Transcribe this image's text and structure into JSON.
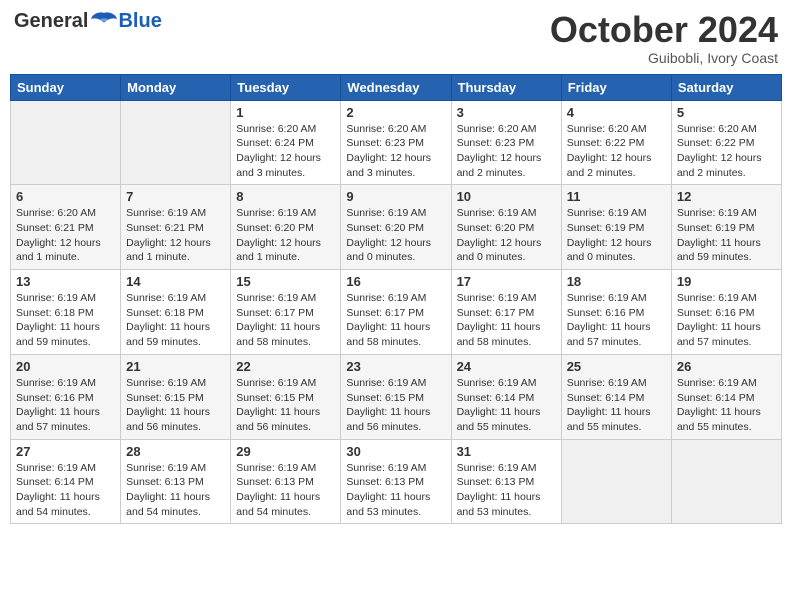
{
  "header": {
    "logo_general": "General",
    "logo_blue": "Blue",
    "month_title": "October 2024",
    "subtitle": "Guibobli, Ivory Coast"
  },
  "days_of_week": [
    "Sunday",
    "Monday",
    "Tuesday",
    "Wednesday",
    "Thursday",
    "Friday",
    "Saturday"
  ],
  "weeks": [
    [
      {
        "day": "",
        "info": ""
      },
      {
        "day": "",
        "info": ""
      },
      {
        "day": "1",
        "info": "Sunrise: 6:20 AM\nSunset: 6:24 PM\nDaylight: 12 hours and 3 minutes."
      },
      {
        "day": "2",
        "info": "Sunrise: 6:20 AM\nSunset: 6:23 PM\nDaylight: 12 hours and 3 minutes."
      },
      {
        "day": "3",
        "info": "Sunrise: 6:20 AM\nSunset: 6:23 PM\nDaylight: 12 hours and 2 minutes."
      },
      {
        "day": "4",
        "info": "Sunrise: 6:20 AM\nSunset: 6:22 PM\nDaylight: 12 hours and 2 minutes."
      },
      {
        "day": "5",
        "info": "Sunrise: 6:20 AM\nSunset: 6:22 PM\nDaylight: 12 hours and 2 minutes."
      }
    ],
    [
      {
        "day": "6",
        "info": "Sunrise: 6:20 AM\nSunset: 6:21 PM\nDaylight: 12 hours and 1 minute."
      },
      {
        "day": "7",
        "info": "Sunrise: 6:19 AM\nSunset: 6:21 PM\nDaylight: 12 hours and 1 minute."
      },
      {
        "day": "8",
        "info": "Sunrise: 6:19 AM\nSunset: 6:20 PM\nDaylight: 12 hours and 1 minute."
      },
      {
        "day": "9",
        "info": "Sunrise: 6:19 AM\nSunset: 6:20 PM\nDaylight: 12 hours and 0 minutes."
      },
      {
        "day": "10",
        "info": "Sunrise: 6:19 AM\nSunset: 6:20 PM\nDaylight: 12 hours and 0 minutes."
      },
      {
        "day": "11",
        "info": "Sunrise: 6:19 AM\nSunset: 6:19 PM\nDaylight: 12 hours and 0 minutes."
      },
      {
        "day": "12",
        "info": "Sunrise: 6:19 AM\nSunset: 6:19 PM\nDaylight: 11 hours and 59 minutes."
      }
    ],
    [
      {
        "day": "13",
        "info": "Sunrise: 6:19 AM\nSunset: 6:18 PM\nDaylight: 11 hours and 59 minutes."
      },
      {
        "day": "14",
        "info": "Sunrise: 6:19 AM\nSunset: 6:18 PM\nDaylight: 11 hours and 59 minutes."
      },
      {
        "day": "15",
        "info": "Sunrise: 6:19 AM\nSunset: 6:17 PM\nDaylight: 11 hours and 58 minutes."
      },
      {
        "day": "16",
        "info": "Sunrise: 6:19 AM\nSunset: 6:17 PM\nDaylight: 11 hours and 58 minutes."
      },
      {
        "day": "17",
        "info": "Sunrise: 6:19 AM\nSunset: 6:17 PM\nDaylight: 11 hours and 58 minutes."
      },
      {
        "day": "18",
        "info": "Sunrise: 6:19 AM\nSunset: 6:16 PM\nDaylight: 11 hours and 57 minutes."
      },
      {
        "day": "19",
        "info": "Sunrise: 6:19 AM\nSunset: 6:16 PM\nDaylight: 11 hours and 57 minutes."
      }
    ],
    [
      {
        "day": "20",
        "info": "Sunrise: 6:19 AM\nSunset: 6:16 PM\nDaylight: 11 hours and 57 minutes."
      },
      {
        "day": "21",
        "info": "Sunrise: 6:19 AM\nSunset: 6:15 PM\nDaylight: 11 hours and 56 minutes."
      },
      {
        "day": "22",
        "info": "Sunrise: 6:19 AM\nSunset: 6:15 PM\nDaylight: 11 hours and 56 minutes."
      },
      {
        "day": "23",
        "info": "Sunrise: 6:19 AM\nSunset: 6:15 PM\nDaylight: 11 hours and 56 minutes."
      },
      {
        "day": "24",
        "info": "Sunrise: 6:19 AM\nSunset: 6:14 PM\nDaylight: 11 hours and 55 minutes."
      },
      {
        "day": "25",
        "info": "Sunrise: 6:19 AM\nSunset: 6:14 PM\nDaylight: 11 hours and 55 minutes."
      },
      {
        "day": "26",
        "info": "Sunrise: 6:19 AM\nSunset: 6:14 PM\nDaylight: 11 hours and 55 minutes."
      }
    ],
    [
      {
        "day": "27",
        "info": "Sunrise: 6:19 AM\nSunset: 6:14 PM\nDaylight: 11 hours and 54 minutes."
      },
      {
        "day": "28",
        "info": "Sunrise: 6:19 AM\nSunset: 6:13 PM\nDaylight: 11 hours and 54 minutes."
      },
      {
        "day": "29",
        "info": "Sunrise: 6:19 AM\nSunset: 6:13 PM\nDaylight: 11 hours and 54 minutes."
      },
      {
        "day": "30",
        "info": "Sunrise: 6:19 AM\nSunset: 6:13 PM\nDaylight: 11 hours and 53 minutes."
      },
      {
        "day": "31",
        "info": "Sunrise: 6:19 AM\nSunset: 6:13 PM\nDaylight: 11 hours and 53 minutes."
      },
      {
        "day": "",
        "info": ""
      },
      {
        "day": "",
        "info": ""
      }
    ]
  ]
}
